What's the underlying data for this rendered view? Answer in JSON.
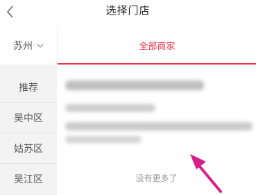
{
  "header": {
    "title": "选择门店",
    "back_icon": "chevron-left-icon"
  },
  "sidebar": {
    "city": {
      "label": "苏州",
      "icon": "chevron-down-icon"
    },
    "districts": [
      {
        "label": "推荐"
      },
      {
        "label": "吴中区"
      },
      {
        "label": "姑苏区"
      },
      {
        "label": "吴江区"
      }
    ]
  },
  "tabs": {
    "active_label": "全部商家"
  },
  "footer": {
    "no_more_text": "没有更多了"
  },
  "colors": {
    "accent": "#e8334a",
    "sidebar_bg": "#f3f3f3",
    "annotation_arrow": "#d81e8c"
  }
}
